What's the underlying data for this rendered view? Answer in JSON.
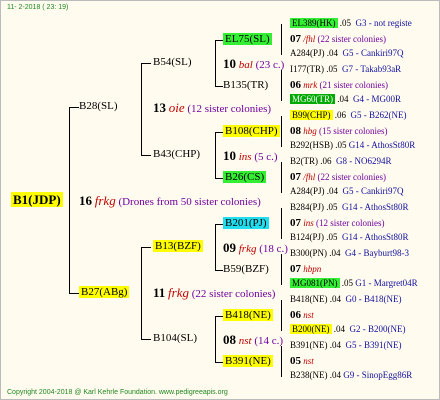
{
  "header": "11-  2-2018 ( 23: 19)",
  "footer": "Copyright 2004-2018 @ Karl Kehrle Foundation.   www.pedigreeapis.org",
  "root": {
    "id": "B1(JDP)",
    "gen": "16",
    "name": "frkg",
    "note": "(Drones from 50 sister colonies)"
  },
  "b28": {
    "id": "B28(SL)",
    "gen": "13",
    "name": "oie",
    "note": "(12 sister colonies)"
  },
  "b27": {
    "id": "B27(ABg)",
    "gen": "11",
    "name": "frkg",
    "note": "(22 sister colonies)"
  },
  "b54": {
    "id": "B54(SL)",
    "gen": "10",
    "name": "bal",
    "note": "(23 c.)"
  },
  "b43": {
    "id": "B43(CHP)",
    "gen": "10",
    "name": "ins",
    "note": "(5 c.)"
  },
  "b13": {
    "id": "B13(BZF)",
    "gen": "09",
    "name": "frkg",
    "note": "(18 c.)"
  },
  "b104": {
    "id": "B104(SL)",
    "gen": "08",
    "name": "nst",
    "note": "(14 c.)"
  },
  "g3": [
    {
      "id": "EL75(SL)"
    },
    {
      "id": "B135(TR)"
    },
    {
      "id": "B108(CHP)"
    },
    {
      "id": "B26(CS)"
    },
    {
      "id": "B201(PJ)"
    },
    {
      "id": "B59(BZF)"
    },
    {
      "id": "B418(NE)"
    },
    {
      "id": "B391(NE)"
    }
  ],
  "g4": [
    {
      "id": "EL389(HK)",
      "val": ".05",
      "ref": "G3 - not registe"
    },
    {
      "gen": "07",
      "name": "/fhl",
      "note": "(22 sister colonies)"
    },
    {
      "id": "A284(PJ)",
      "val": ".04",
      "ref": "G5 - Cankiri97Q"
    },
    {
      "id": "I177(TR)",
      "val": ".05",
      "ref": "G7 - Takab93aR"
    },
    {
      "gen": "06",
      "name": "mrk",
      "note": "(21 sister colonies)"
    },
    {
      "id": "MG60(TR)",
      "val": ".04",
      "ref": "G4 - MG00R"
    },
    {
      "id": "B99(CHP)",
      "val": ".06",
      "ref": "G5 - B262(NE)"
    },
    {
      "gen": "08",
      "name": "hbg",
      "note": "(15 sister colonies)"
    },
    {
      "id": "B292(HSB)",
      "val": ".05",
      "ref": "G14 - AthosSt80R"
    },
    {
      "id": "B2(TR)",
      "val": ".06",
      "ref": "G8 - NO6294R"
    },
    {
      "gen": "07",
      "name": "/fhl",
      "note": "(22 sister colonies)"
    },
    {
      "id": "A284(PJ)",
      "val": ".04",
      "ref": "G5 - Cankiri97Q"
    },
    {
      "id": "B284(PJ)",
      "val": ".05",
      "ref": "G14 - AthosSt80R"
    },
    {
      "gen": "07",
      "name": "ins",
      "note": "(12 sister colonies)"
    },
    {
      "id": "B124(PJ)",
      "val": ".05",
      "ref": "G14 - AthosSt80R"
    },
    {
      "id": "B300(PN)",
      "val": ".04",
      "ref": "G4 - Bayburt98-3"
    },
    {
      "gen": "07",
      "name": "hbpn",
      "note": ""
    },
    {
      "id": "MG081(PN)",
      "val": ".05",
      "ref": "G1 - Margret04R"
    },
    {
      "id": "B418(NE)",
      "val": ".04",
      "ref": "G0 - B418(NE)"
    },
    {
      "gen": "06",
      "name": "nst",
      "note": ""
    },
    {
      "id": "B200(NE)",
      "val": ".04",
      "ref": "G2 - B200(NE)"
    },
    {
      "id": "B391(NE)",
      "val": ".04",
      "ref": "G5 - B391(NE)"
    },
    {
      "gen": "05",
      "name": "nst",
      "note": ""
    },
    {
      "id": "B238(NE)",
      "val": ".04",
      "ref": "G9 - SinopEgg86R"
    }
  ]
}
